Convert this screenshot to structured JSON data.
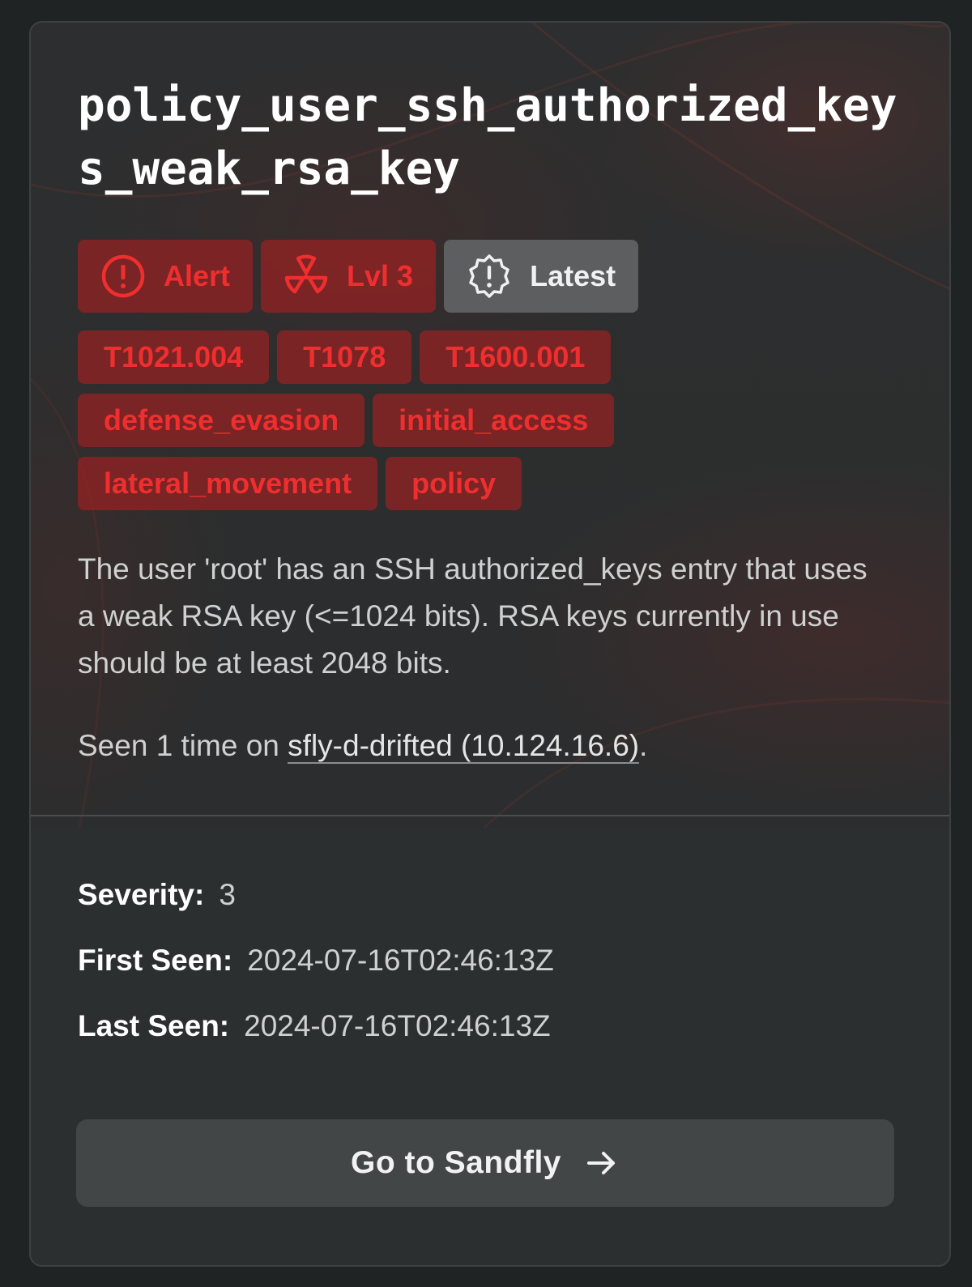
{
  "card": {
    "title": "policy_user_ssh_authorized_keys_weak_rsa_key",
    "status_badges": [
      {
        "label": "Alert",
        "icon": "alert-circle-icon",
        "color": "#ef2f2f"
      },
      {
        "label": "Lvl 3",
        "icon": "radiation-icon",
        "color": "#ef2f2f"
      },
      {
        "label": "Latest",
        "icon": "alert-badge-icon",
        "color": "#f1f1f1"
      }
    ],
    "tags": [
      "T1021.004",
      "T1078",
      "T1600.001",
      "defense_evasion",
      "initial_access",
      "lateral_movement",
      "policy"
    ],
    "description": "The user 'root' has an SSH authorized_keys entry that uses a weak RSA key (<=1024 bits). RSA keys currently in use should be at least 2048 bits.",
    "seen_prefix": "Seen 1 time on ",
    "seen_host": "sfly-d-drifted (10.124.16.6)",
    "seen_suffix": "."
  },
  "details": {
    "severity_label": "Severity:",
    "severity_value": "3",
    "first_seen_label": "First Seen:",
    "first_seen_value": "2024-07-16T02:46:13Z",
    "last_seen_label": "Last Seen:",
    "last_seen_value": "2024-07-16T02:46:13Z"
  },
  "action": {
    "label": "Go to Sandfly",
    "icon": "arrow-right-icon"
  },
  "colors": {
    "accent_red": "#ef2f2f",
    "badge_red_bg": "#a01e20",
    "card_bg": "#2c2f30",
    "page_bg": "#202323"
  }
}
